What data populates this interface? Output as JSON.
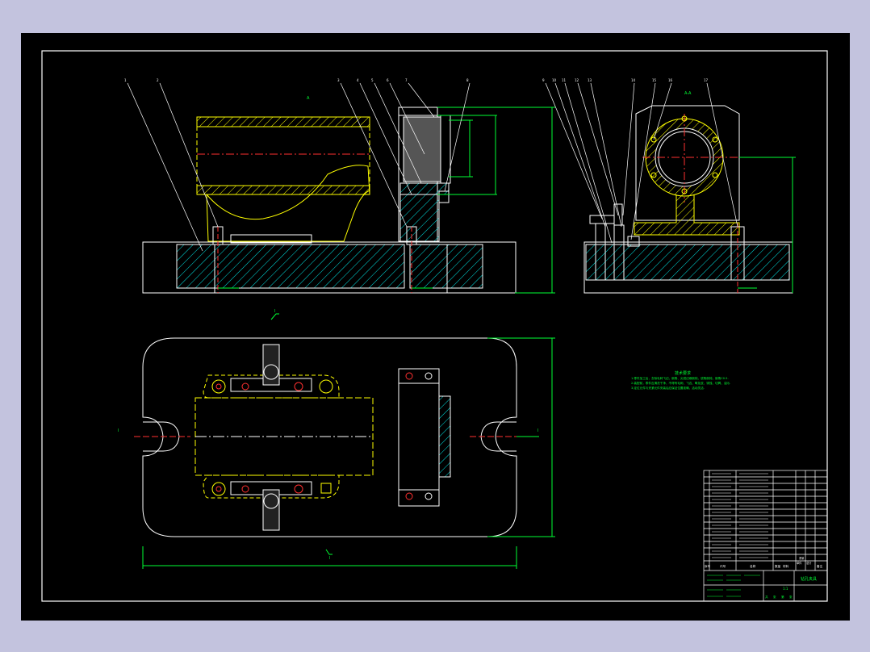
{
  "drawing": {
    "view_labels": {
      "front": "A",
      "side": "A-A",
      "section_top": "I",
      "section_left": "I",
      "section_right": "I",
      "section_bottom": "I"
    },
    "leader_tags": [
      "1",
      "2",
      "3",
      "4",
      "5",
      "6",
      "7",
      "8",
      "9",
      "10",
      "11",
      "12",
      "13",
      "14",
      "15",
      "16",
      "17",
      "18"
    ],
    "technical_requirements": {
      "title": "技术要求",
      "lines": [
        "1.零件加工后，去除毛刺飞边，倒角、尖锐边缘倒钝，锐角倒钝，倒角C0.5.",
        "2.装配前，零件应清洗干净，不得有毛刺、飞边、氧化皮、锈蚀、切屑、油污.",
        "3.定位元件与夹紧元件安装后应保证位置准确，活动灵活."
      ]
    },
    "title_block": {
      "col_headers": [
        "序号",
        "代号",
        "名称",
        "数量",
        "材料",
        "单件",
        "总计",
        "备注"
      ],
      "weight_label": "重量",
      "drawing_name": "钻孔夹具",
      "scale": "1:1",
      "sheet_labels": [
        "共",
        "张",
        "第",
        "张"
      ]
    },
    "colors": {
      "outline": "#ffffff",
      "hatch": "#00e5e5",
      "dimension": "#00ff33",
      "hidden": "#ffff00",
      "center": "#ff3030",
      "part": "#ff00ff",
      "border": "#ffffff"
    }
  }
}
